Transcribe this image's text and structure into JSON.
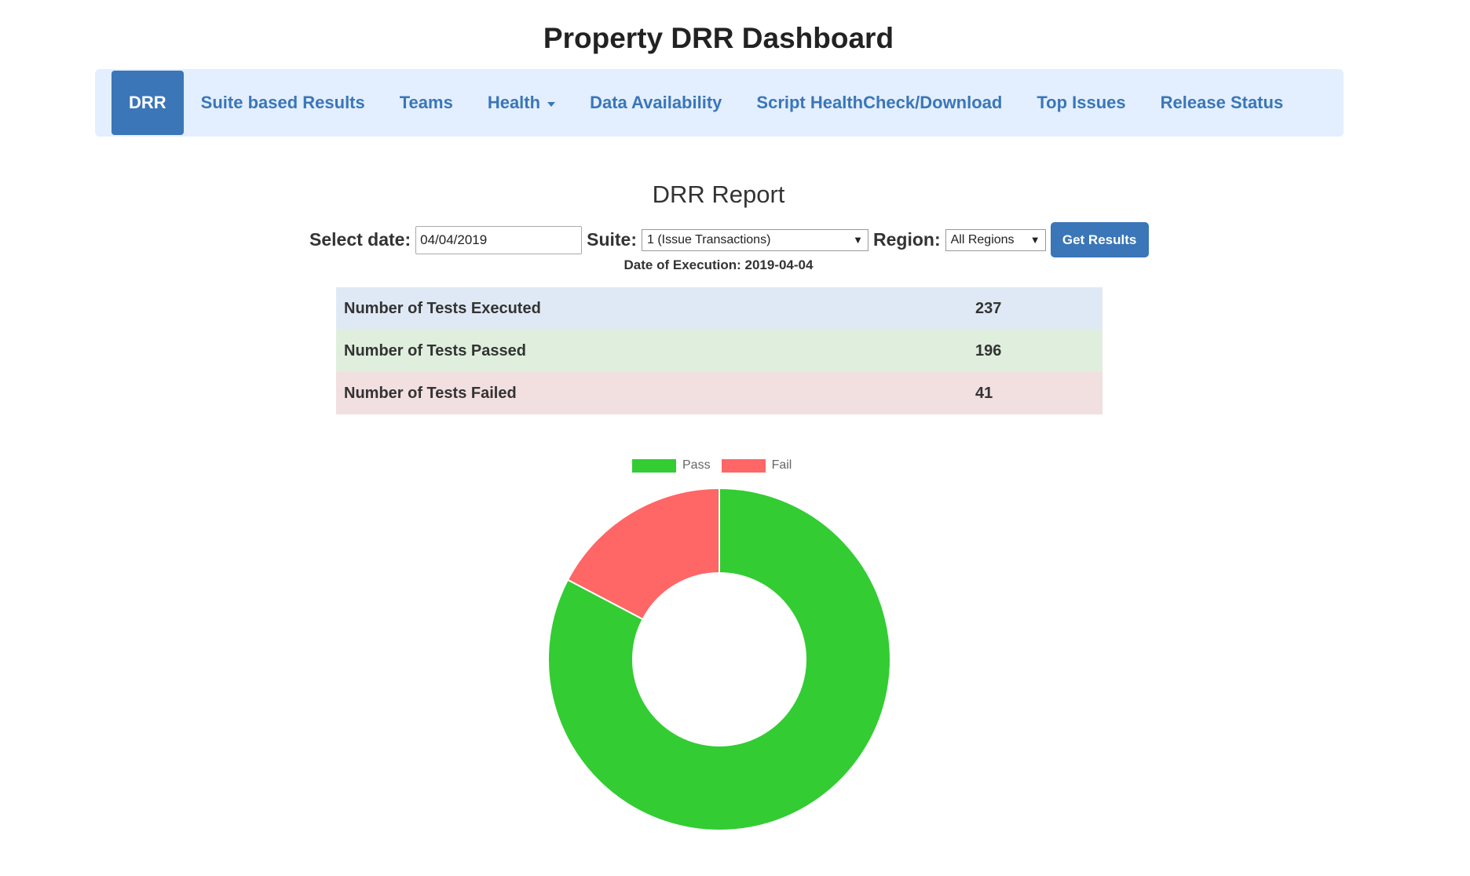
{
  "page_title": "Property DRR Dashboard",
  "nav": {
    "items": [
      {
        "label": "DRR",
        "active": true
      },
      {
        "label": "Suite based Results"
      },
      {
        "label": "Teams"
      },
      {
        "label": "Health",
        "dropdown": true
      },
      {
        "label": "Data Availability"
      },
      {
        "label": "Script HealthCheck/Download"
      },
      {
        "label": "Top Issues"
      },
      {
        "label": "Release Status"
      }
    ],
    "accent_color": "#3a76b8",
    "background_color": "#e3efff"
  },
  "report": {
    "title": "DRR Report",
    "filters": {
      "date_label": "Select date:",
      "date_value": "04/04/2019",
      "suite_label": "Suite:",
      "suite_value": "1 (Issue Transactions)",
      "region_label": "Region:",
      "region_value": "All Regions",
      "button_label": "Get Results"
    },
    "execution_date": "Date of Execution: 2019-04-04",
    "stats": [
      {
        "label": "Number of Tests Executed",
        "value": "237"
      },
      {
        "label": "Number of Tests Passed",
        "value": "196"
      },
      {
        "label": "Number of Tests Failed",
        "value": "41"
      }
    ]
  },
  "chart_data": {
    "type": "pie",
    "donut": true,
    "legend_position": "top",
    "categories": [
      "Pass",
      "Fail"
    ],
    "values": [
      196,
      41
    ],
    "colors": [
      "#33cc33",
      "#ff6666"
    ]
  }
}
